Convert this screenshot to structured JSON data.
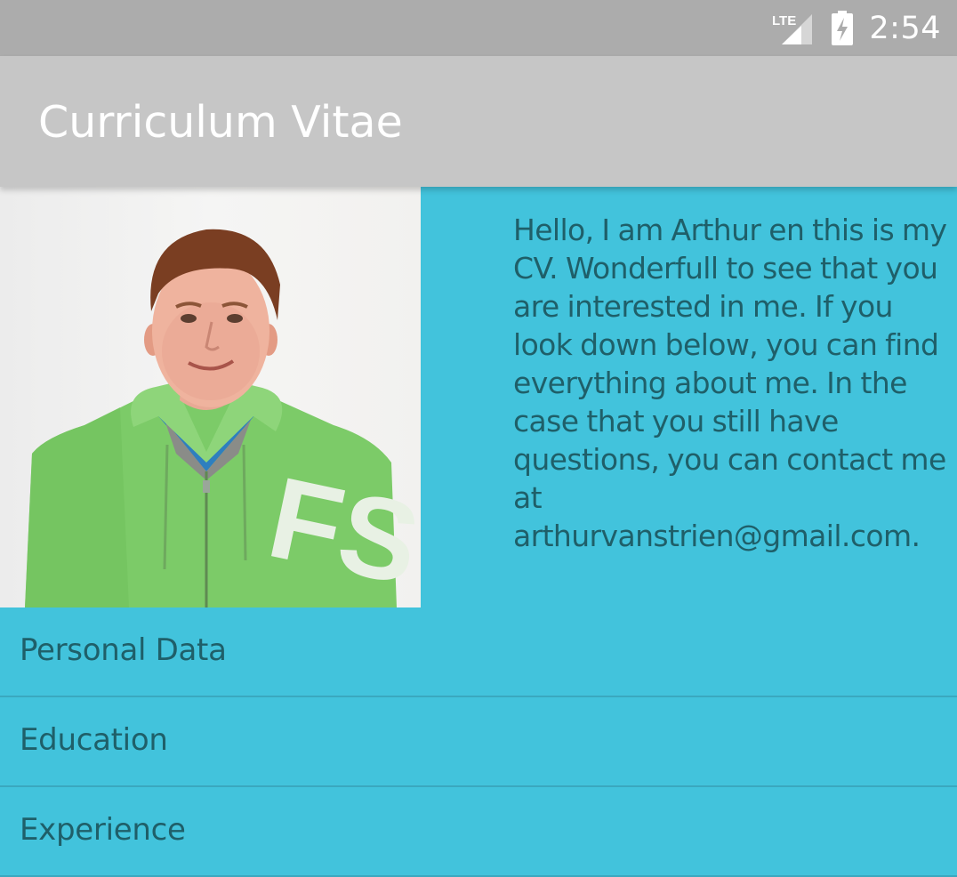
{
  "status_bar": {
    "network": "LTE",
    "time": "2:54",
    "icons": [
      "lte-signal-icon",
      "battery-charging-icon"
    ]
  },
  "app_bar": {
    "title": "Curriculum Vitae"
  },
  "profile": {
    "photo": "portrait-photo",
    "photo_print": "FS",
    "intro": "Hello, I am Arthur en this is my CV. Wonderfull to see that you are interested in me. If you look down below, you can find everything about me. In the case that you still have questions, you can contact me at arthurvanstrien@gmail.com."
  },
  "sections": [
    {
      "label": "Personal Data"
    },
    {
      "label": "Education"
    },
    {
      "label": "Experience"
    }
  ],
  "colors": {
    "status_bar": "#ACACAC",
    "app_bar": "#C6C6C6",
    "background": "#42C3DC",
    "text": "#1F5F69",
    "divider": "#3AA8BF"
  }
}
